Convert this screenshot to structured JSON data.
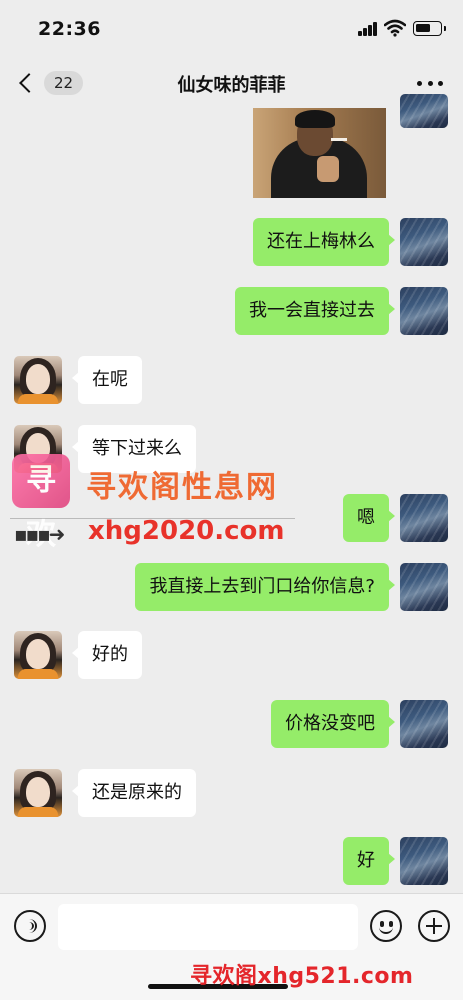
{
  "status_bar": {
    "time": "22:36"
  },
  "nav": {
    "unread_count": "22",
    "title": "仙女味的菲菲"
  },
  "messages": [
    {
      "from": "self",
      "text": "还在上梅林么"
    },
    {
      "from": "self",
      "text": "我一会直接过去"
    },
    {
      "from": "other",
      "text": "在呢"
    },
    {
      "from": "other",
      "text": "等下过来么"
    },
    {
      "from": "self",
      "text": "嗯"
    },
    {
      "from": "self",
      "text": "我直接上去到门口给你信息?"
    },
    {
      "from": "other",
      "text": "好的"
    },
    {
      "from": "self",
      "text": "价格没变吧"
    },
    {
      "from": "other",
      "text": "还是原来的"
    },
    {
      "from": "self",
      "text": "好"
    }
  ],
  "watermark": {
    "logo": "寻欢",
    "title": "寻欢阁性息网",
    "url": "xhg2020.com",
    "footer": "寻欢阁xhg521.com"
  },
  "colors": {
    "background": "#ededed",
    "self_bubble": "#95ec69",
    "other_bubble": "#ffffff",
    "watermark_orange": "#f0632a",
    "watermark_red": "#e8322a"
  },
  "icons": [
    "back-chevron-icon",
    "more-dots-icon",
    "voice-icon",
    "emoji-icon",
    "plus-icon",
    "signal-icon",
    "wifi-icon",
    "battery-icon"
  ]
}
